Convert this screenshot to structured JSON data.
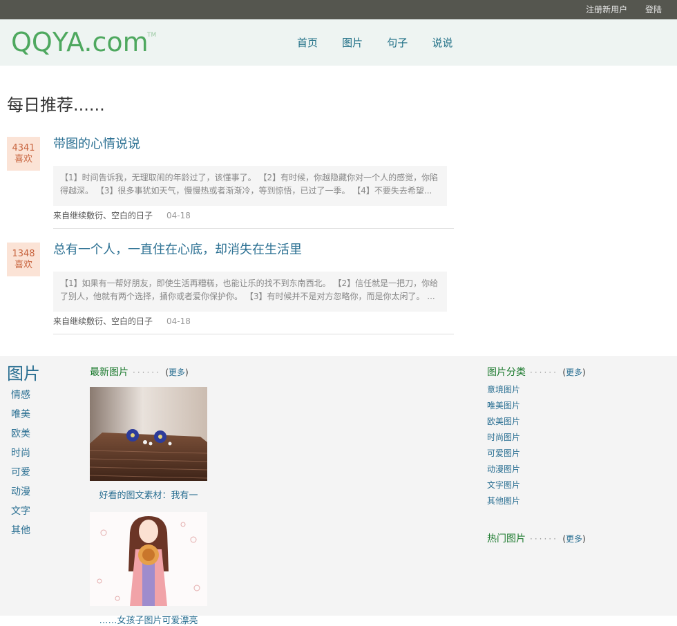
{
  "topbar": {
    "register": "注册新用户",
    "login": "登陆"
  },
  "logo": {
    "text": "QQYA.com",
    "tm": "TM"
  },
  "nav": [
    "首页",
    "图片",
    "句子",
    "说说"
  ],
  "daily": {
    "title": "每日推荐......",
    "items": [
      {
        "likes": "4341",
        "likes_label": "喜欢",
        "title": "带图的心情说说",
        "excerpt": "【1】时间告诉我，无理取闹的年龄过了，该懂事了。 【2】有时候，你越隐藏你对一个人的感觉，你陷得越深。 【3】很多事犹如天气，慢慢热或者渐渐冷，等到惊悟，已过了一季。 【4】不要失去希望...",
        "source": "来自继续敷衍、空白的日子",
        "date": "04-18"
      },
      {
        "likes": "1348",
        "likes_label": "喜欢",
        "title": "总有一个人，一直住在心底，却消失在生活里",
        "excerpt": "【1】如果有一帮好朋友，即使生活再糟糕，也能让乐的找不到东南西北。 【2】信任就是一把刀，你给了别人，他就有两个选择，捅你或者爱你保护你。 【3】有时候并不是对方忽略你，而是你太闲了。 ...",
        "source": "来自继续敷衍、空白的日子",
        "date": "04-18"
      }
    ]
  },
  "pictures": {
    "title": "图片",
    "categories": [
      "情感",
      "唯美",
      "欧美",
      "时尚",
      "可爱",
      "动漫",
      "文字",
      "其他"
    ],
    "latest_head": "最新图片",
    "more_prefix": "(",
    "more": "更多",
    "more_suffix": ")",
    "latest": [
      {
        "caption": "好看的图文素材：我有一"
      },
      {
        "caption": "……女孩子图片可爱漂亮"
      }
    ],
    "class_head": "图片分类",
    "classes": [
      "意境图片",
      "唯美图片",
      "欧美图片",
      "时尚图片",
      "可爱图片",
      "动漫图片",
      "文字图片",
      "其他图片"
    ],
    "hot_head": "热门图片"
  }
}
